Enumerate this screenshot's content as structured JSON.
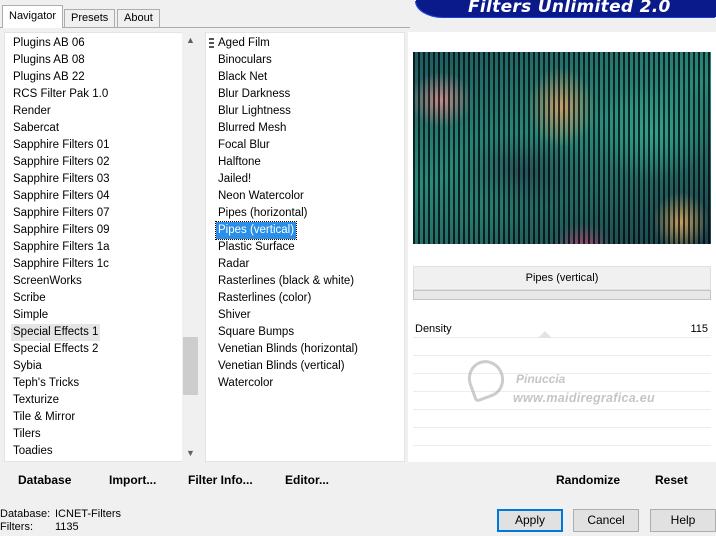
{
  "window": {
    "title": "Filters Unlimited 2.0"
  },
  "tabs": [
    {
      "label": "Navigator",
      "active": true
    },
    {
      "label": "Presets",
      "active": false
    },
    {
      "label": "About",
      "active": false
    }
  ],
  "categories": {
    "items": [
      "Plugins AB 06",
      "Plugins AB 08",
      "Plugins AB 22",
      "RCS Filter Pak 1.0",
      "Render",
      "Sabercat",
      "Sapphire Filters 01",
      "Sapphire Filters 02",
      "Sapphire Filters 03",
      "Sapphire Filters 04",
      "Sapphire Filters 07",
      "Sapphire Filters 09",
      "Sapphire Filters 1a",
      "Sapphire Filters 1c",
      "ScreenWorks",
      "Scribe",
      "Simple",
      "Special Effects 1",
      "Special Effects 2",
      "Sybia",
      "Teph's Tricks",
      "Texturize",
      "Tile & Mirror",
      "Tilers",
      "Toadies"
    ],
    "selected_index": 17
  },
  "filters": {
    "items": [
      "Aged Film",
      "Binoculars",
      "Black Net",
      "Blur Darkness",
      "Blur Lightness",
      "Blurred Mesh",
      "Focal Blur",
      "Halftone",
      "Jailed!",
      "Neon Watercolor",
      "Pipes (horizontal)",
      "Pipes (vertical)",
      "Plastic Surface",
      "Radar",
      "Rasterlines (black & white)",
      "Rasterlines (color)",
      "Shiver",
      "Square Bumps",
      "Venetian Blinds (horizontal)",
      "Venetian Blinds (vertical)",
      "Watercolor"
    ],
    "selected_index": 11
  },
  "preview": {
    "filter_name": "Pipes (vertical)",
    "params": [
      {
        "label": "Density",
        "value": "115"
      }
    ],
    "watermark": {
      "name": "Pinuccia",
      "site": "www.maidiregrafica.eu"
    }
  },
  "left_buttons": {
    "database": "Database",
    "import": "Import...",
    "filter_info": "Filter Info...",
    "editor": "Editor..."
  },
  "right_buttons": {
    "randomize": "Randomize",
    "reset": "Reset"
  },
  "status": {
    "database_label": "Database:",
    "database_value": "ICNET-Filters",
    "filters_label": "Filters:",
    "filters_value": "1135"
  },
  "dialog_buttons": {
    "apply": "Apply",
    "cancel": "Cancel",
    "help": "Help"
  },
  "colors": {
    "selection": "#2a8fe8",
    "banner": "#0a1a8a",
    "default_button_border": "#0078d7"
  }
}
